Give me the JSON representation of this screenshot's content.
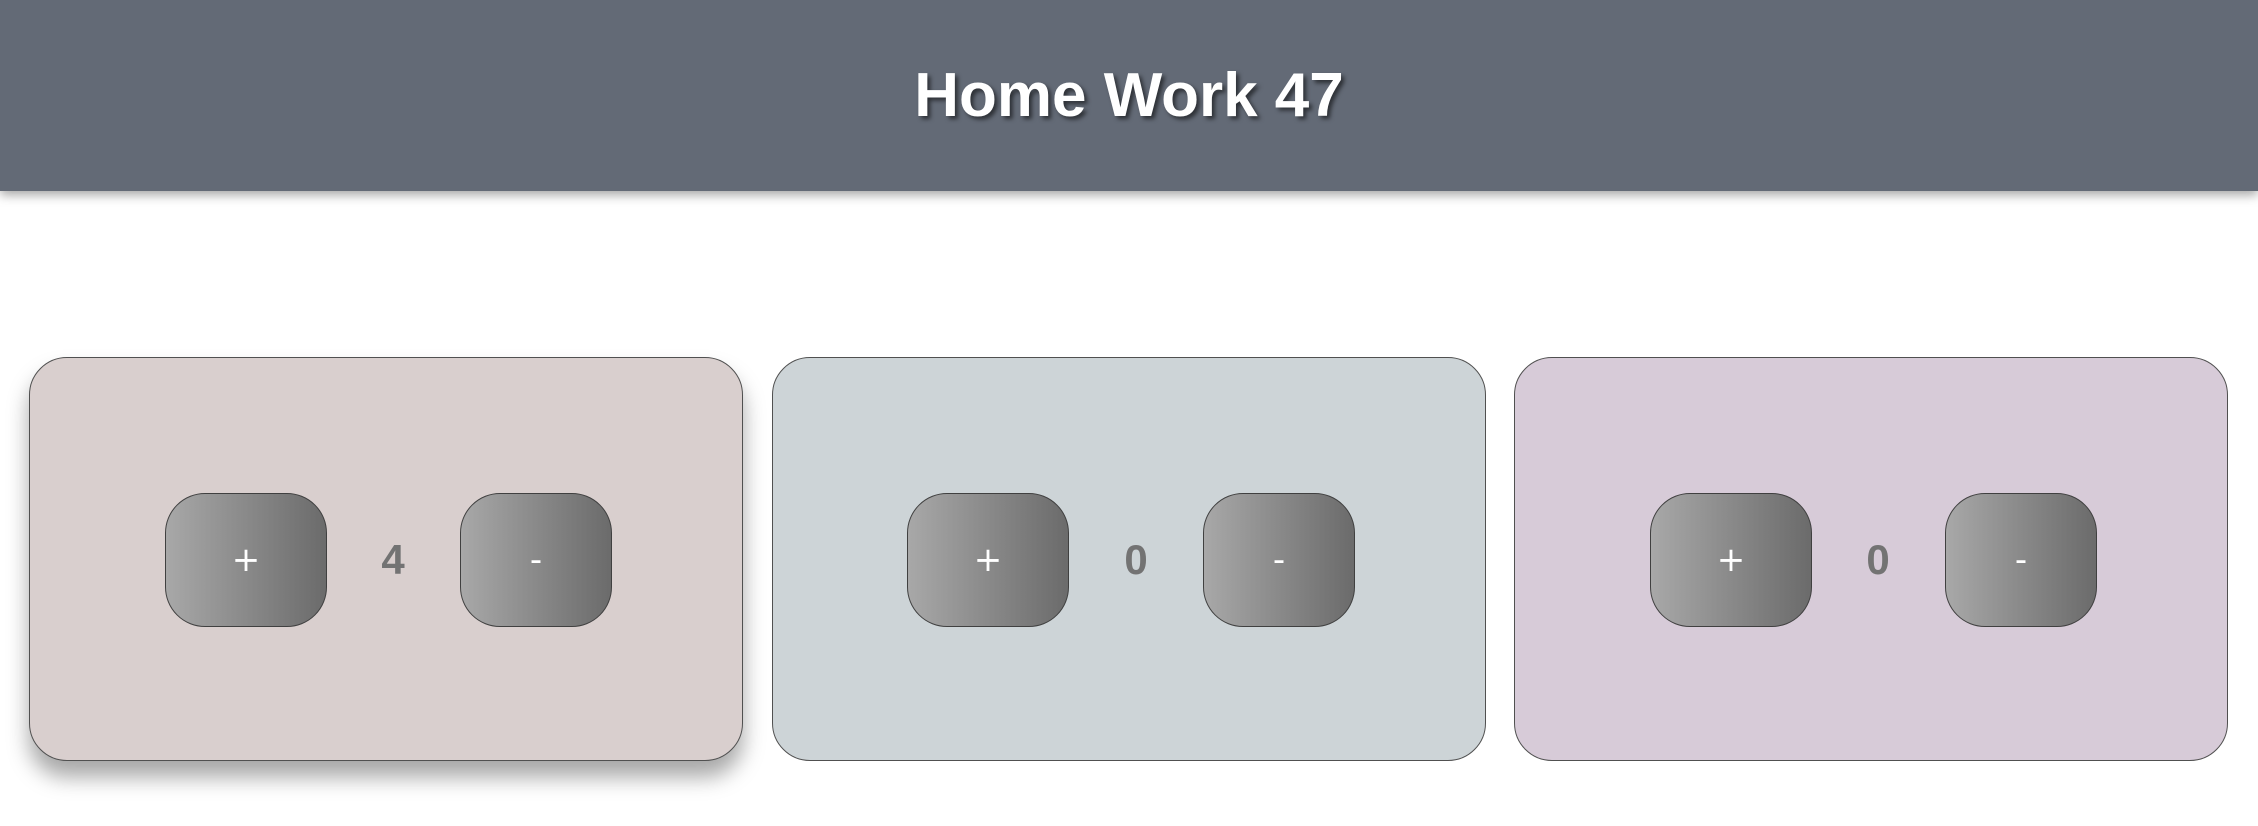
{
  "header": {
    "title": "Home Work 47"
  },
  "counters": [
    {
      "plus_label": "+",
      "minus_label": "-",
      "value": "4",
      "background": "#d9cfce",
      "active": true
    },
    {
      "plus_label": "+",
      "minus_label": "-",
      "value": "0",
      "background": "#cdd4d7",
      "active": false
    },
    {
      "plus_label": "+",
      "minus_label": "-",
      "value": "0",
      "background": "#d7cbd8",
      "active": false
    }
  ]
}
